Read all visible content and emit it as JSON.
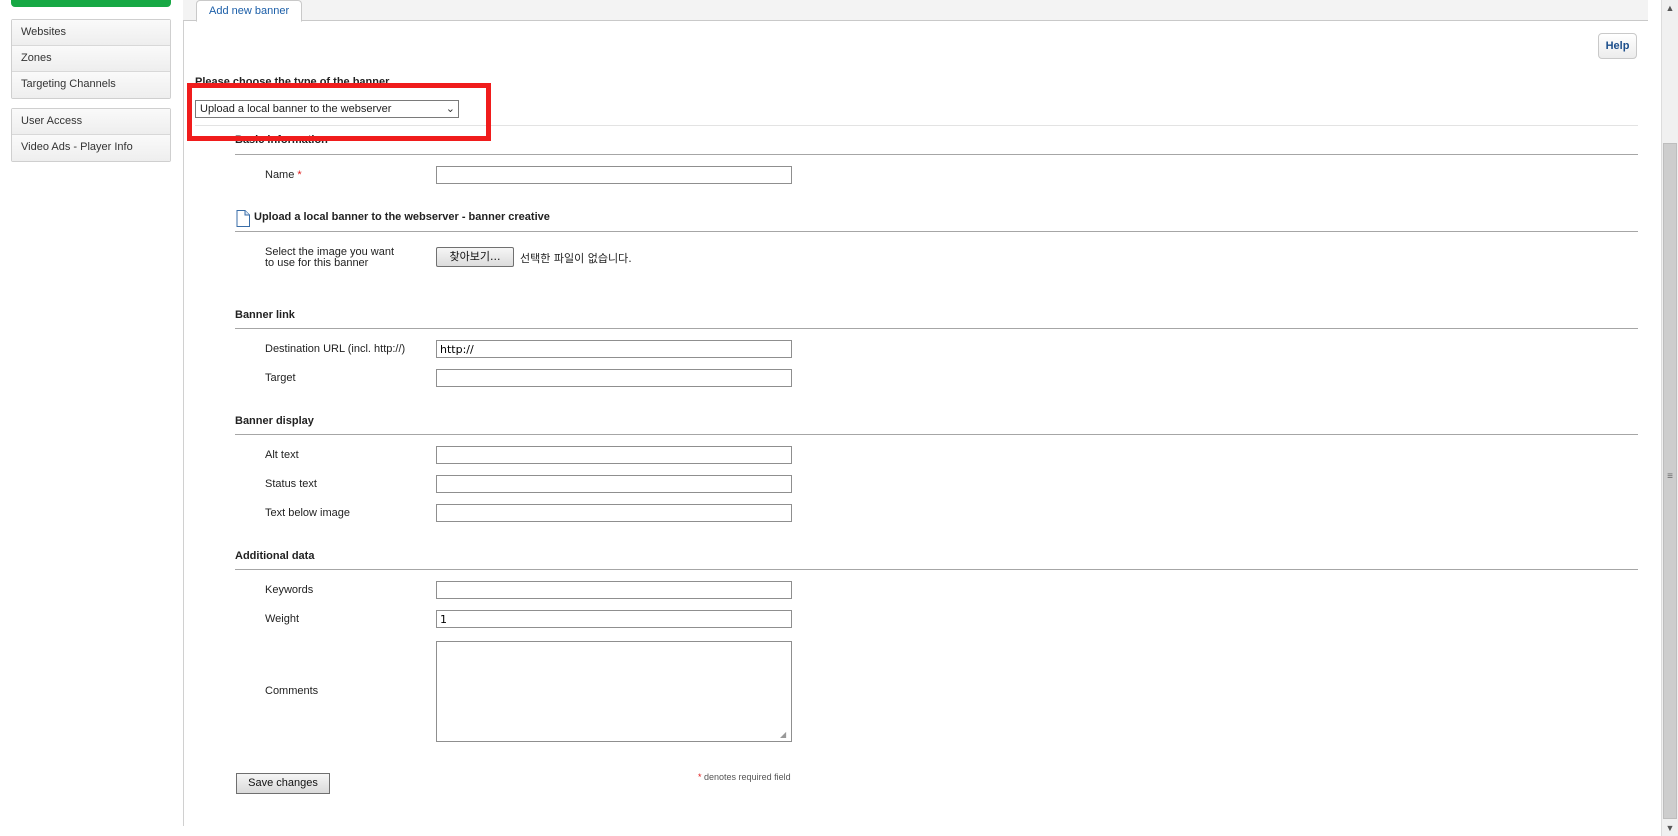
{
  "sidebar": {
    "group1": [
      {
        "label": "Websites"
      },
      {
        "label": "Zones"
      },
      {
        "label": "Targeting Channels"
      }
    ],
    "group2": [
      {
        "label": "User Access"
      },
      {
        "label": "Video Ads - Player Info"
      }
    ]
  },
  "tabs": {
    "active": "Add new banner"
  },
  "help_label": "Help",
  "banner_type": {
    "prompt": "Please choose the type of the banner",
    "selected": "Upload a local banner to the webserver"
  },
  "sections": {
    "basic": {
      "title": "Basic information",
      "name_label": "Name",
      "required_marker": "*",
      "name_value": ""
    },
    "creative": {
      "title": "Upload a local banner to the webserver - banner creative",
      "image_label_line1": "Select the image you want",
      "image_label_line2": "to use for this banner",
      "browse_label": "찾아보기...",
      "no_file_text": "선택한 파일이 없습니다."
    },
    "link": {
      "title": "Banner link",
      "url_label": "Destination URL (incl. http://)",
      "url_value": "http://",
      "target_label": "Target",
      "target_value": ""
    },
    "display": {
      "title": "Banner display",
      "alt_label": "Alt text",
      "status_label": "Status text",
      "below_label": "Text below image"
    },
    "additional": {
      "title": "Additional data",
      "keywords_label": "Keywords",
      "weight_label": "Weight",
      "weight_value": "1",
      "comments_label": "Comments"
    }
  },
  "save_label": "Save changes",
  "required_note": "denotes required field",
  "scrollbar": {
    "up_glyph": "▲",
    "down_glyph": "▼",
    "grip_glyph": "≡"
  },
  "colors": {
    "accent_green": "#17a844",
    "highlight_red": "#f01c1c",
    "link_blue": "#1b5ea8"
  },
  "icons": {
    "document": "document-icon",
    "dropdown": "chevron-down-icon"
  }
}
